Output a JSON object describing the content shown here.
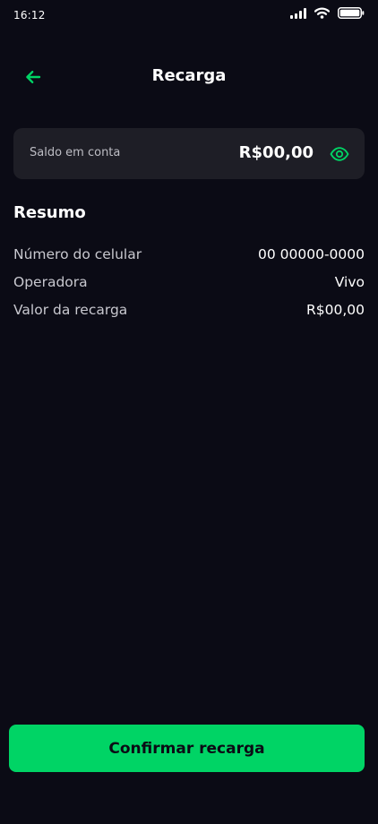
{
  "status_bar": {
    "time": "16:12",
    "signal_icon": "cellular-signal-icon",
    "wifi_icon": "wifi-icon",
    "battery_icon": "battery-icon"
  },
  "header": {
    "back_icon": "arrow-left-icon",
    "title": "Recarga"
  },
  "balance": {
    "label": "Saldo em conta",
    "value": "R$00,00",
    "visibility_icon": "eye-icon"
  },
  "summary": {
    "title": "Resumo",
    "rows": [
      {
        "label": "Número do celular",
        "value": "00 00000-0000"
      },
      {
        "label": "Operadora",
        "value": "Vivo"
      },
      {
        "label": "Valor da recarga",
        "value": "R$00,00"
      }
    ]
  },
  "actions": {
    "confirm_label": "Confirmar recarga"
  },
  "colors": {
    "background": "#0b0b15",
    "card": "#1e1e26",
    "accent": "#00d465",
    "text": "#ffffff",
    "muted_text": "#c8c8cf"
  }
}
